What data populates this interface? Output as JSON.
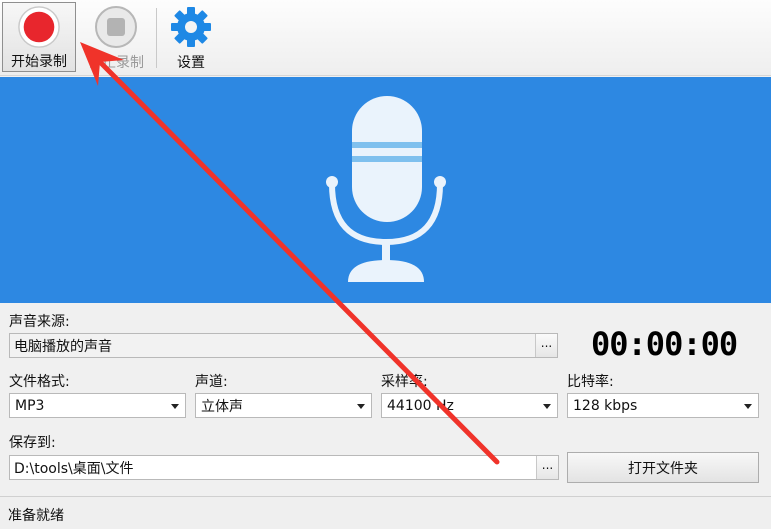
{
  "toolbar": {
    "start_label": "开始录制",
    "stop_label": "停止录制",
    "settings_label": "设置"
  },
  "source": {
    "label": "声音来源:",
    "value": "电脑播放的声音",
    "browse": "..."
  },
  "timer": "00:00:00",
  "format": {
    "label": "文件格式:",
    "value": "MP3"
  },
  "channel": {
    "label": "声道:",
    "value": "立体声"
  },
  "sample_rate": {
    "label": "采样率:",
    "value": "44100 Hz"
  },
  "bitrate": {
    "label": "比特率:",
    "value": "128 kbps"
  },
  "save": {
    "label": "保存到:",
    "path": "D:\\tools\\桌面\\文件",
    "browse": "...",
    "open_folder": "打开文件夹"
  },
  "status": "准备就绪",
  "colors": {
    "banner": "#2d88e2",
    "record": "#e8262d",
    "arrow": "#f0332a"
  }
}
